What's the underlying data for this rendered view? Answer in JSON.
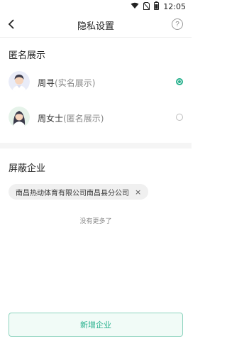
{
  "status_bar": {
    "time": "12:05",
    "icons": [
      "wifi-icon",
      "no-sim-icon",
      "battery-icon"
    ]
  },
  "header": {
    "title": "隐私设置",
    "help": "?"
  },
  "anonymous_section": {
    "title": "匿名展示",
    "options": [
      {
        "name": "周寻",
        "mode": "(实名展示)",
        "selected": true
      },
      {
        "name": "周女士",
        "mode": "(匿名展示)",
        "selected": false
      }
    ]
  },
  "blocked_section": {
    "title": "屏蔽企业",
    "companies": [
      "南昌热动体育有限公司南昌县分公司"
    ],
    "remove_symbol": "×",
    "empty_hint": "没有更多了"
  },
  "footer": {
    "add_button_label": "新增企业"
  },
  "colors": {
    "accent": "#2bb28f",
    "button_bg": "#f1fbf7"
  }
}
